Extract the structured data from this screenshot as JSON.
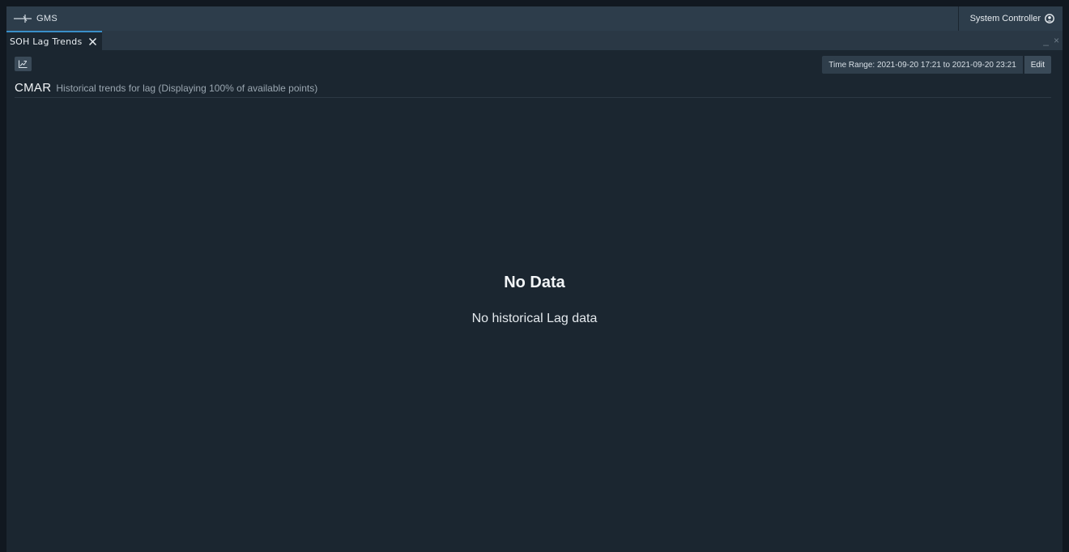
{
  "app": {
    "title": "GMS",
    "user_label": "System Controller",
    "icons": {
      "logo": "gms-logo-icon",
      "user": "user-icon"
    }
  },
  "tabs": [
    {
      "label": "SOH Lag Trends",
      "active": true,
      "close_icon": "close-icon"
    }
  ],
  "window_controls": {
    "minimize": "_",
    "close": "×"
  },
  "toolbar": {
    "chart_options_icon": "chart-icon",
    "time_range_label": "Time Range: 2021-09-20 17:21 to 2021-09-20 23:21",
    "edit_label": "Edit"
  },
  "header": {
    "station": "CMAR",
    "subtitle": "Historical trends for lag (Displaying 100% of available points)"
  },
  "empty_state": {
    "title": "No Data",
    "message": "No historical Lag data"
  },
  "colors": {
    "background": "#1b2630",
    "top_bar": "#2d3d4b",
    "tab_accent": "#3a8fc9"
  }
}
